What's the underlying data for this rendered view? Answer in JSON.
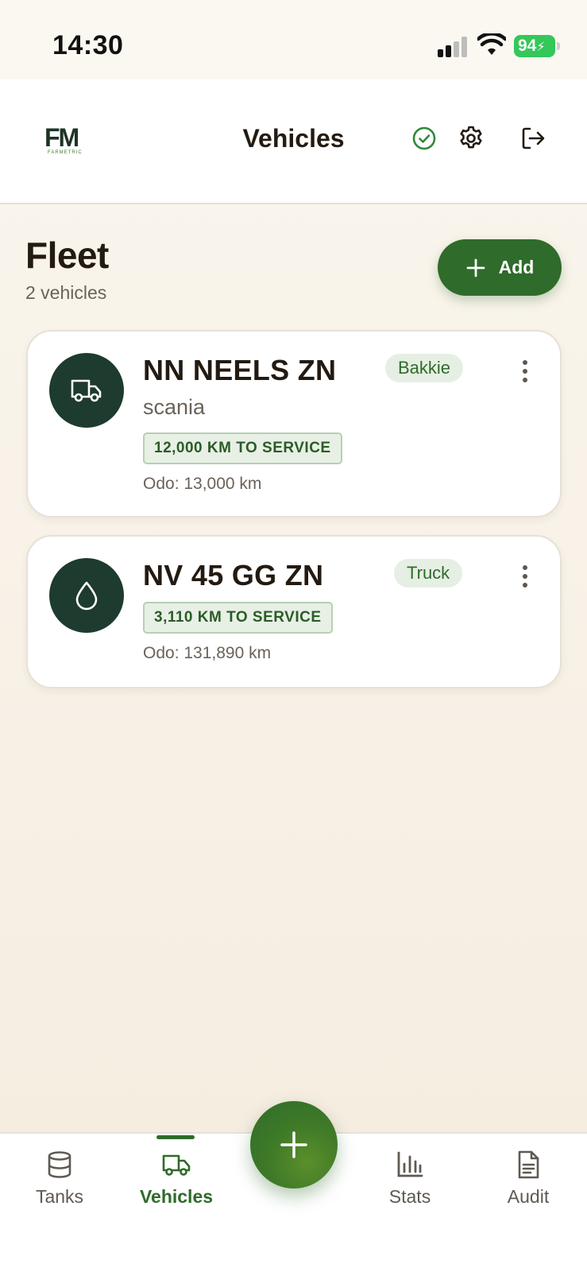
{
  "status_bar": {
    "time": "14:30",
    "battery_level": "94"
  },
  "header": {
    "logo_text": "FM",
    "logo_subtext": "FARMETRIC",
    "title": "Vehicles",
    "icons": [
      "check-circle-icon",
      "gear-icon",
      "logout-icon"
    ]
  },
  "fleet": {
    "title": "Fleet",
    "count_label": "2 vehicles",
    "add_label": "Add"
  },
  "vehicles": [
    {
      "plate": "NN NEELS ZN",
      "make": "scania",
      "type": "Bakkie",
      "service": "12,000 KM TO SERVICE",
      "odo": "Odo: 13,000 km",
      "icon": "truck-icon"
    },
    {
      "plate": "NV 45 GG ZN",
      "type": "Truck",
      "service": "3,110 KM TO SERVICE",
      "odo": "Odo: 131,890 km",
      "icon": "fuel-drop-icon"
    }
  ],
  "nav": {
    "items": [
      {
        "label": "Tanks",
        "icon": "database-icon"
      },
      {
        "label": "Vehicles",
        "icon": "truck-icon",
        "active": true
      },
      {
        "label": "Stats",
        "icon": "bar-chart-icon"
      },
      {
        "label": "Audit",
        "icon": "document-icon"
      }
    ],
    "fab_icon": "plus-icon"
  },
  "colors": {
    "brand_green": "#2f6b2a",
    "avatar_dark": "#1d3b2e",
    "battery_green": "#34c759",
    "background": "#f7efe4"
  }
}
